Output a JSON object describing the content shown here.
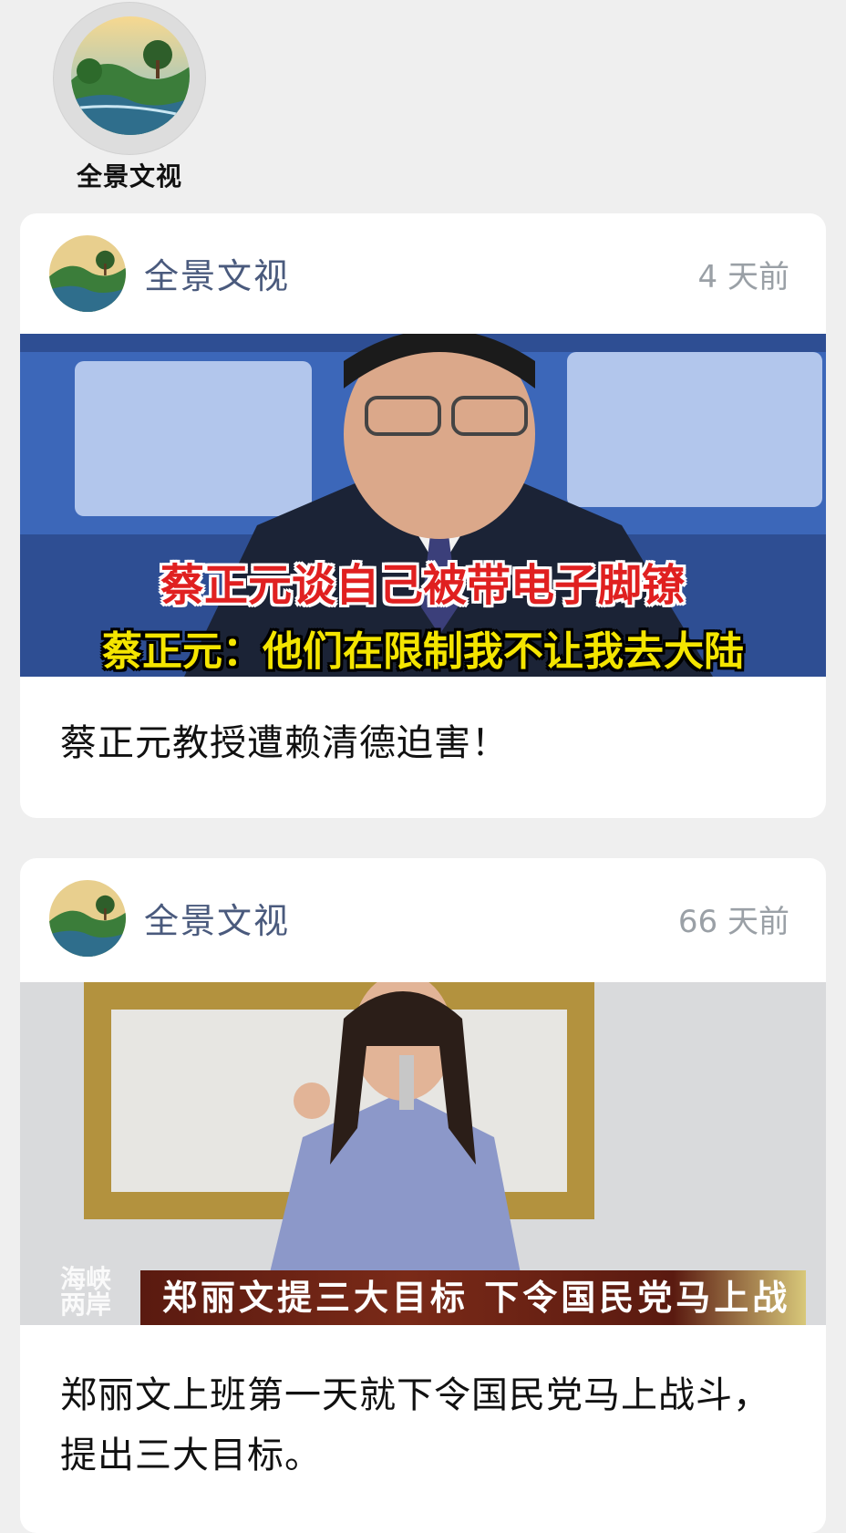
{
  "profile": {
    "name": "全景文视"
  },
  "posts": [
    {
      "author": "全景文视",
      "time": "4 天前",
      "media": {
        "caption_top": "蔡正元谈自己被带电子脚镣",
        "caption_bottom": "蔡正元：他们在限制我不让我去大陆"
      },
      "text": "蔡正元教授遭赖清德迫害！"
    },
    {
      "author": "全景文视",
      "time": "66 天前",
      "media": {
        "caption_bar": "郑丽文提三大目标 下令国民党马上战斗",
        "logo": "海峡两岸"
      },
      "text": "郑丽文上班第一天就下令国民党马上战斗，提出三大目标。"
    }
  ]
}
